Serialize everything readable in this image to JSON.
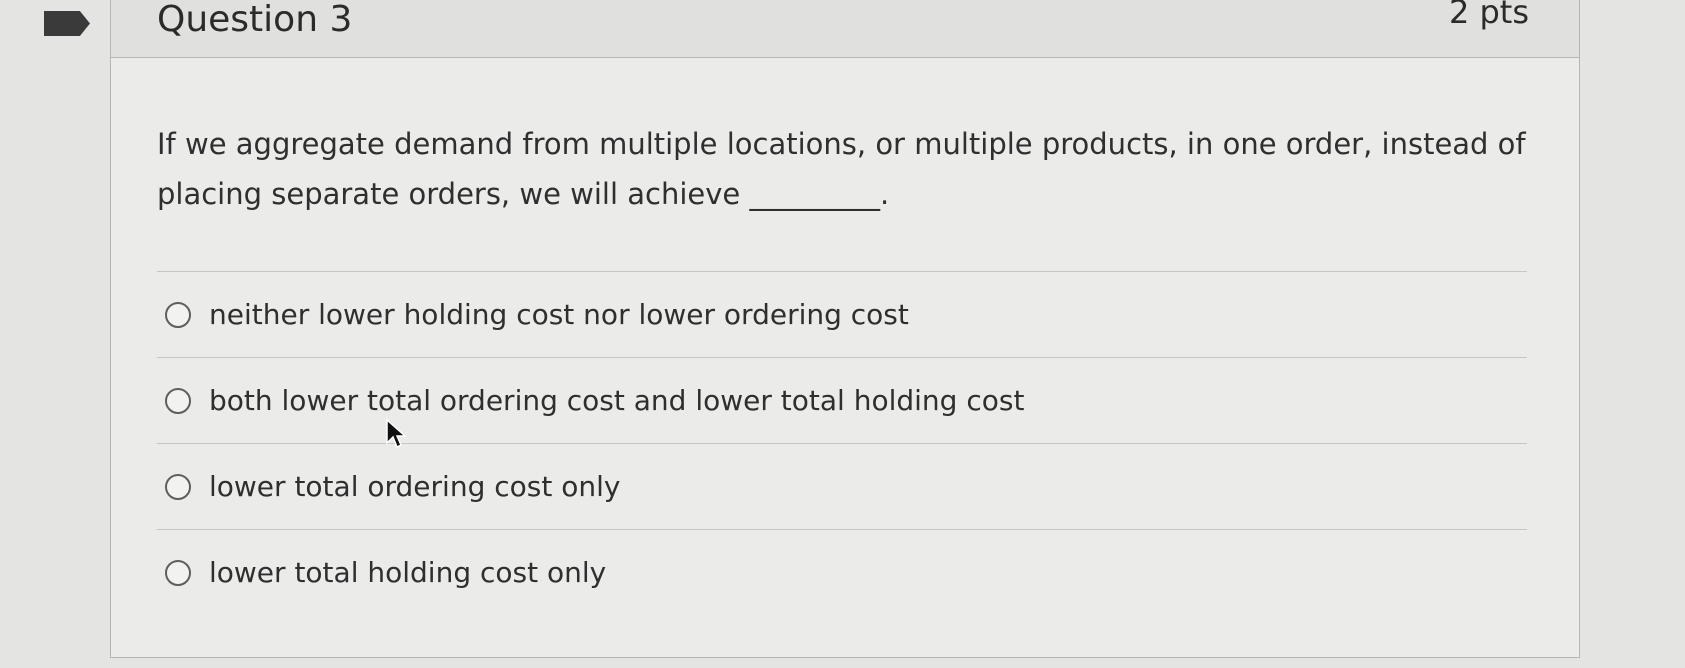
{
  "question": {
    "title": "Question 3",
    "points": "2 pts",
    "prompt": "If we aggregate demand from multiple locations, or multiple products, in one order, instead of placing separate orders, we will achieve _________."
  },
  "options": [
    {
      "label": "neither lower holding cost nor lower ordering cost",
      "selected": false
    },
    {
      "label": "both lower total ordering cost and lower total holding cost",
      "selected": false
    },
    {
      "label": "lower total ordering cost only",
      "selected": false
    },
    {
      "label": "lower total holding cost only",
      "selected": false
    }
  ],
  "icons": {
    "flag": "flag-icon",
    "cursor": "mouse-pointer-icon"
  },
  "colors": {
    "background": "#e4e4e2",
    "card": "#ebebea",
    "header": "#e0e0de",
    "text": "#2f2f2f"
  }
}
